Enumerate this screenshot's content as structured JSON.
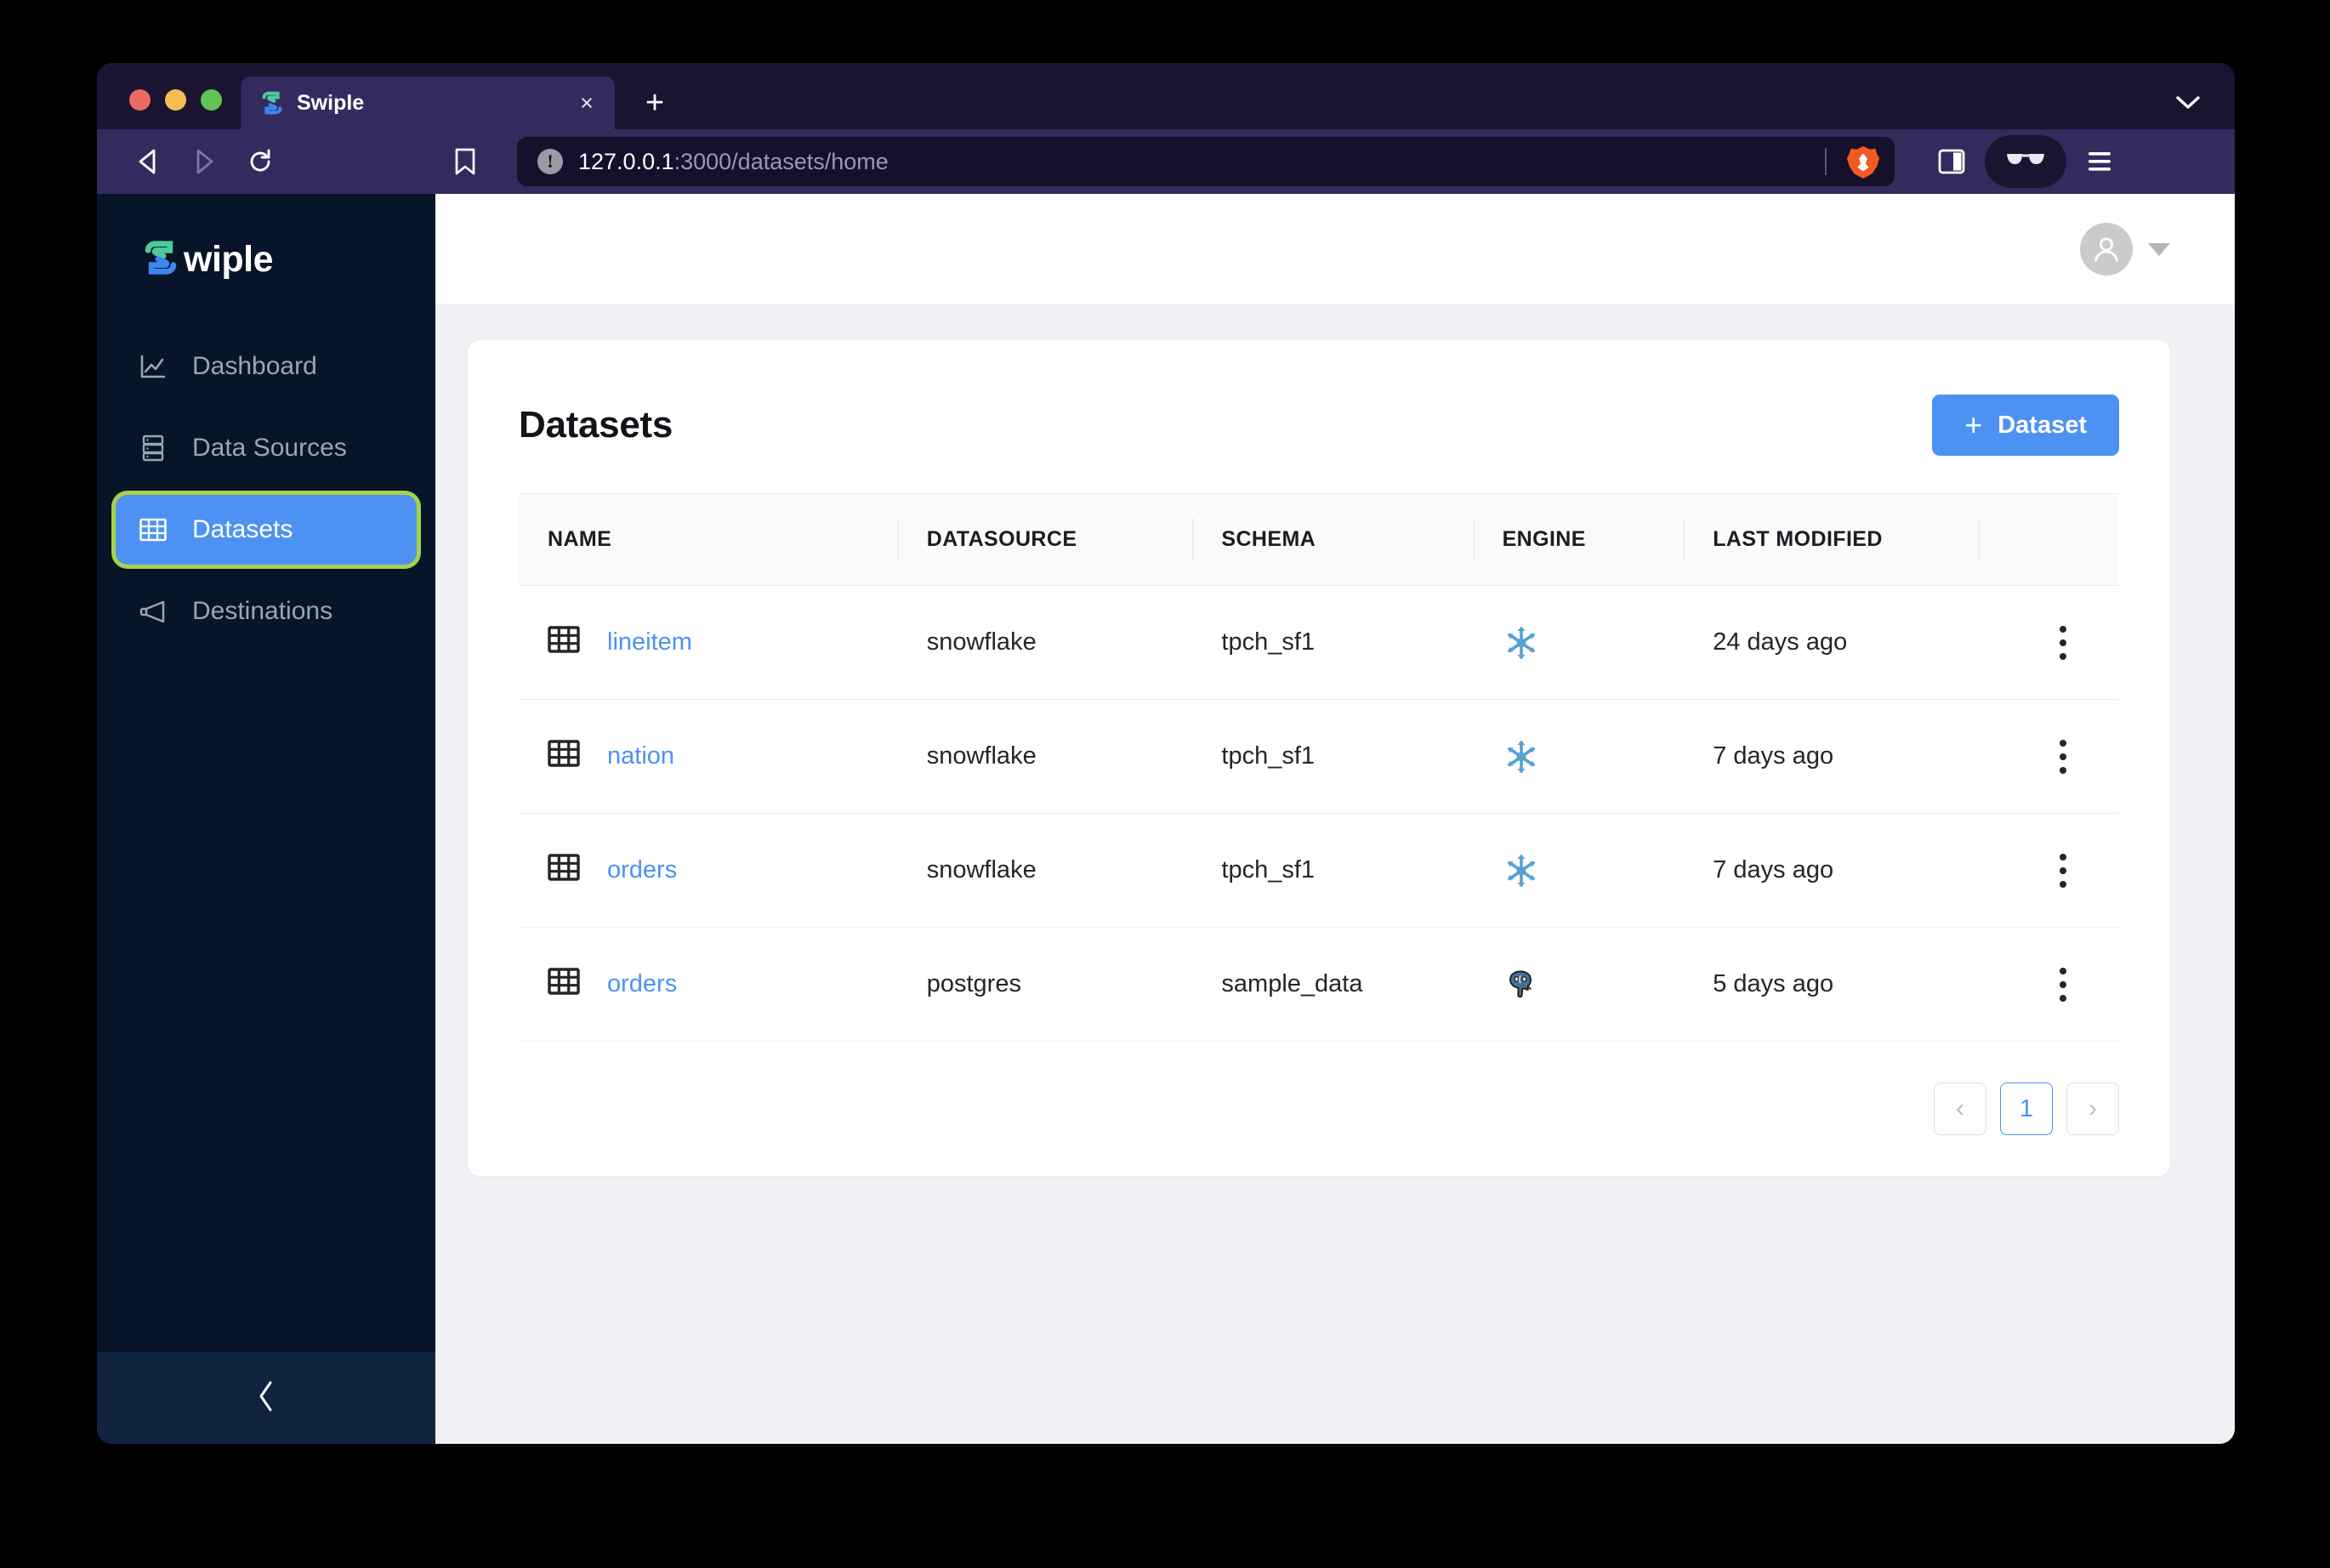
{
  "browser": {
    "tab": {
      "title": "Swiple",
      "favicon": "swiple-logo-icon",
      "close_label": "×"
    },
    "new_tab_label": "+",
    "tabstrip_chevron": "chevron-down-icon",
    "nav": {
      "back": "back-arrow-icon",
      "forward": "forward-arrow-icon",
      "reload": "reload-icon",
      "bookmark": "bookmark-icon"
    },
    "url": {
      "warning_glyph": "!",
      "host": "127.0.0.1",
      "path": ":3000/datasets/home"
    },
    "right_icons": {
      "brave_shield": "brave-lion-icon",
      "sidebar_panel": "sidebar-panel-icon",
      "private_window": "glasses-icon",
      "menu": "hamburger-menu-icon"
    }
  },
  "sidebar": {
    "logo_text": "wiple",
    "items": [
      {
        "label": "Dashboard",
        "icon": "chart-line-icon",
        "active": false
      },
      {
        "label": "Data Sources",
        "icon": "database-icon",
        "active": false
      },
      {
        "label": "Datasets",
        "icon": "table-grid-icon",
        "active": true
      },
      {
        "label": "Destinations",
        "icon": "megaphone-icon",
        "active": false
      }
    ],
    "collapse_icon": "chevron-left-icon"
  },
  "topbar": {
    "avatar": "user-avatar-icon",
    "caret": "caret-down-icon"
  },
  "main": {
    "title": "Datasets",
    "add_button": {
      "plus": "+",
      "label": "Dataset"
    },
    "table": {
      "columns": [
        "NAME",
        "DATASOURCE",
        "SCHEMA",
        "ENGINE",
        "LAST MODIFIED",
        ""
      ],
      "rows": [
        {
          "icon": "table-grid-icon",
          "name": "lineitem",
          "datasource": "snowflake",
          "schema": "tpch_sf1",
          "engine": "snowflake",
          "last_modified": "24 days ago",
          "actions": "kebab-menu-icon"
        },
        {
          "icon": "table-grid-icon",
          "name": "nation",
          "datasource": "snowflake",
          "schema": "tpch_sf1",
          "engine": "snowflake",
          "last_modified": "7 days ago",
          "actions": "kebab-menu-icon"
        },
        {
          "icon": "table-grid-icon",
          "name": "orders",
          "datasource": "snowflake",
          "schema": "tpch_sf1",
          "engine": "snowflake",
          "last_modified": "7 days ago",
          "actions": "kebab-menu-icon"
        },
        {
          "icon": "table-grid-icon",
          "name": "orders",
          "datasource": "postgres",
          "schema": "sample_data",
          "engine": "postgres",
          "last_modified": "5 days ago",
          "actions": "kebab-menu-icon"
        }
      ]
    },
    "pagination": {
      "prev": "‹",
      "page": "1",
      "next": "›"
    }
  },
  "colors": {
    "accent_blue": "#4d92f2",
    "focus_ring_green": "#a6d24b",
    "sidebar_navy": "#081427",
    "content_gray": "#eff1f5",
    "snowflake_blue": "#56a0d3",
    "postgres_blue": "#336791",
    "browser_chrome": "#342a5e"
  }
}
